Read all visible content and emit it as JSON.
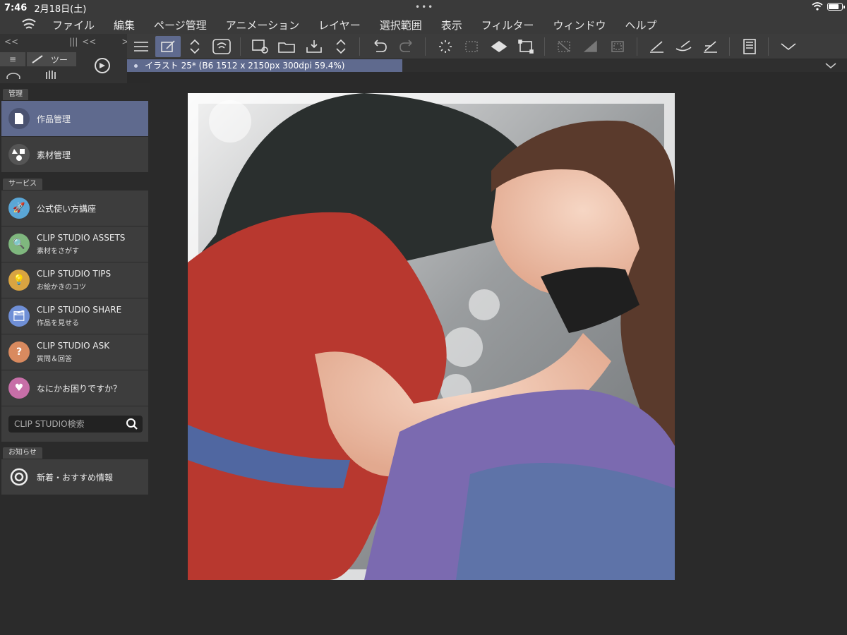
{
  "status_bar": {
    "time": "7:46",
    "date": "2月18日(土)",
    "battery_level": 0.8
  },
  "menu": {
    "items": [
      "ファイル",
      "編集",
      "ページ管理",
      "アニメーション",
      "レイヤー",
      "選択範囲",
      "表示",
      "フィルター",
      "ウィンドウ",
      "ヘルプ"
    ]
  },
  "mini_panel": {
    "tab_label": "ツー"
  },
  "document": {
    "tab_title": "イラスト 25* (B6 1512 x 2150px 300dpi 59.4%)"
  },
  "sidebar": {
    "sections": {
      "manage": "管理",
      "services": "サービス",
      "news": "お知らせ"
    },
    "manage_items": [
      {
        "label": "作品管理"
      },
      {
        "label": "素材管理"
      }
    ],
    "service_items": [
      {
        "label": "公式使い方講座",
        "sub": "",
        "color": "#5aa6d6"
      },
      {
        "label": "CLIP STUDIO ASSETS",
        "sub": "素材をさがす",
        "color": "#7fb77e"
      },
      {
        "label": "CLIP STUDIO TIPS",
        "sub": "お絵かきのコツ",
        "color": "#d9a441"
      },
      {
        "label": "CLIP STUDIO SHARE",
        "sub": "作品を見せる",
        "color": "#6f8fd6"
      },
      {
        "label": "CLIP STUDIO ASK",
        "sub": "質問＆回答",
        "color": "#d98a5f"
      },
      {
        "label": "なにかお困りですか？",
        "sub": "",
        "color": "#c76fa8"
      }
    ],
    "search_placeholder": "CLIP STUDIO検索",
    "news_item": "新着・おすすめ情報"
  },
  "colors": {
    "accent": "#5f6a8e",
    "panel": "#3d3d3d",
    "background": "#2a2a2a"
  }
}
